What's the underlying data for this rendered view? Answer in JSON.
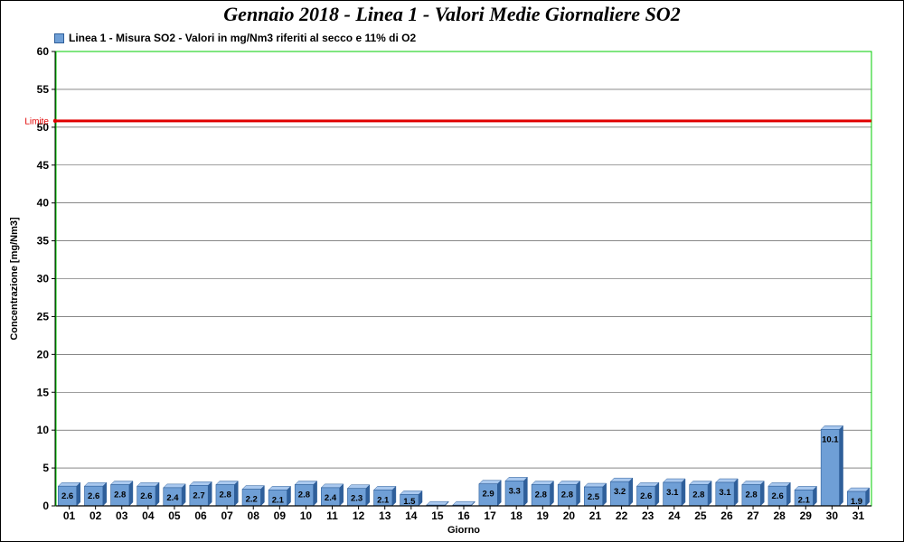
{
  "chart_data": {
    "type": "bar",
    "title": "Gennaio 2018 - Linea 1 - Valori Medie Giornaliere SO2",
    "series": [
      {
        "name": "Linea 1 - Misura SO2 - Valori in mg/Nm3 riferiti al secco e 11% di O2",
        "color": "#6f9fd6",
        "values": [
          2.6,
          2.6,
          2.8,
          2.6,
          2.4,
          2.7,
          2.8,
          2.2,
          2.1,
          2.8,
          2.4,
          2.3,
          2.1,
          1.5,
          0.1,
          0.1,
          2.9,
          3.3,
          2.8,
          2.8,
          2.5,
          3.2,
          2.6,
          3.1,
          2.8,
          3.1,
          2.8,
          2.6,
          2.1,
          10.1,
          1.9
        ],
        "value_labels": [
          "2.6",
          "2.6",
          "2.8",
          "2.6",
          "2.4",
          "2.7",
          "2.8",
          "2.2",
          "2.1",
          "2.8",
          "2.4",
          "2.3",
          "2.1",
          "1.5",
          "",
          "",
          "2.9",
          "3.3",
          "2.8",
          "2.8",
          "2.5",
          "3.2",
          "2.6",
          "3.1",
          "2.8",
          "3.1",
          "2.8",
          "2.6",
          "2.1",
          "10.1",
          "1.9"
        ]
      }
    ],
    "categories": [
      "01",
      "02",
      "03",
      "04",
      "05",
      "06",
      "07",
      "08",
      "09",
      "10",
      "11",
      "12",
      "13",
      "14",
      "15",
      "16",
      "17",
      "18",
      "19",
      "20",
      "21",
      "22",
      "23",
      "24",
      "25",
      "26",
      "27",
      "28",
      "29",
      "30",
      "31"
    ],
    "xlabel": "Giorno",
    "ylabel": "Concentrazione [mg/Nm3]",
    "ylim": [
      0,
      60
    ],
    "yticks": [
      "0",
      "5",
      "10",
      "15",
      "20",
      "25",
      "30",
      "35",
      "40",
      "45",
      "50",
      "55",
      "60"
    ],
    "grid": true,
    "legend_position": "top-left",
    "limit_line": {
      "label": "Limite",
      "value": 50,
      "color": "#e00000"
    },
    "colors": {
      "plot_border": "#00cc00",
      "grid": "#000000",
      "bar_front": "#6f9fd6",
      "bar_top": "#a9c8ee",
      "bar_side": "#2f5f9a"
    }
  }
}
